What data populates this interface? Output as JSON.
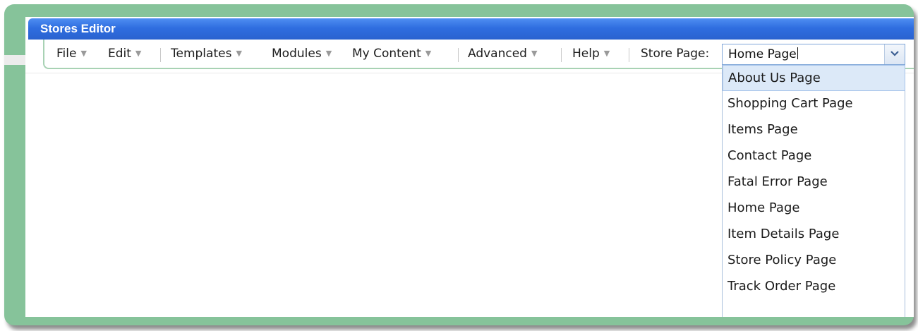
{
  "window": {
    "title": "Stores Editor"
  },
  "toolbar": {
    "menus": [
      "File",
      "Edit",
      "Templates",
      "Modules",
      "My Content",
      "Advanced",
      "Help"
    ],
    "store_page_label": "Store Page:"
  },
  "store_page_combo": {
    "value": "Home Page",
    "options": [
      "About Us Page",
      "Shopping Cart Page",
      "Items Page",
      "Contact Page",
      "Fatal Error Page",
      "Home Page",
      "Item Details Page",
      "Store Policy Page",
      "Track Order Page"
    ],
    "highlighted": "About Us Page"
  },
  "colors": {
    "frame": "#86c39a",
    "title_bar": "#2f6ee0",
    "selection": "#dce9f8"
  }
}
